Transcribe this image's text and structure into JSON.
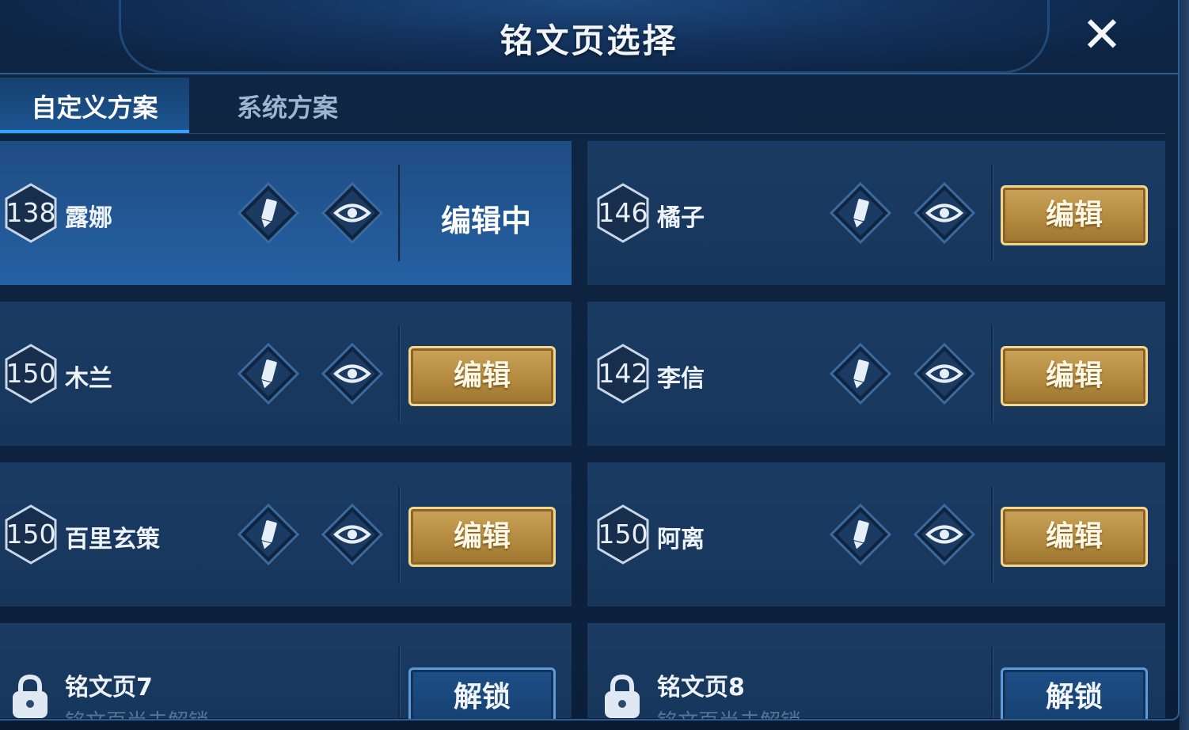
{
  "header": {
    "title": "铭文页选择",
    "close_label": "✕"
  },
  "tabs": [
    {
      "label": "自定义方案",
      "active": true
    },
    {
      "label": "系统方案",
      "active": false
    }
  ],
  "pages": [
    {
      "level": "138",
      "hero": "露娜",
      "status": "编辑中",
      "selected": true
    },
    {
      "level": "146",
      "hero": "橘子",
      "button": "编辑"
    },
    {
      "level": "150",
      "hero": "木兰",
      "button": "编辑"
    },
    {
      "level": "142",
      "hero": "李信",
      "button": "编辑"
    },
    {
      "level": "150",
      "hero": "百里玄策",
      "button": "编辑"
    },
    {
      "level": "150",
      "hero": "阿离",
      "button": "编辑"
    }
  ],
  "locked_pages": [
    {
      "title": "铭文页7",
      "subtitle": "铭文页尚未解锁",
      "button": "解锁"
    },
    {
      "title": "铭文页8",
      "subtitle": "铭文页尚未解锁",
      "button": "解锁"
    }
  ],
  "icons": {
    "edit": "pencil-icon",
    "view": "eye-icon",
    "lock": "lock-icon"
  },
  "colors": {
    "accent_blue": "#3aa0ff",
    "gold_button": "#b48a3f",
    "selected_card": "#2561a3"
  }
}
